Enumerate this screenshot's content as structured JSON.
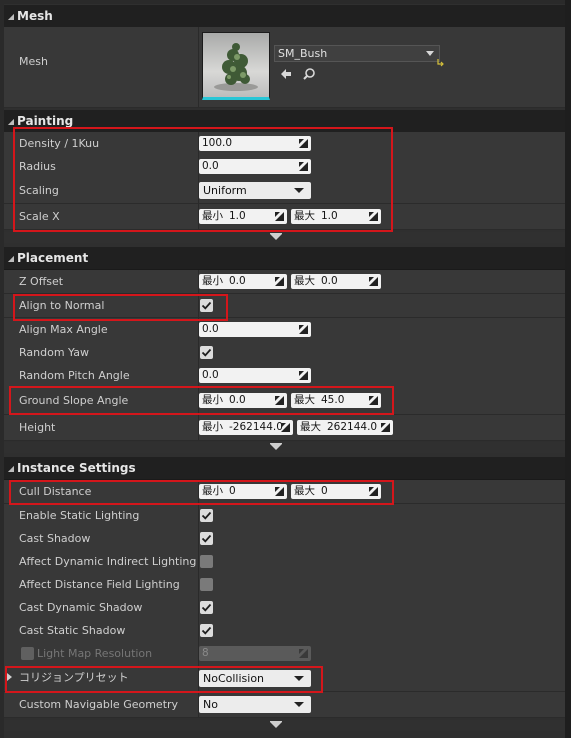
{
  "sections": {
    "mesh": {
      "title": "Mesh"
    },
    "painting": {
      "title": "Painting"
    },
    "placement": {
      "title": "Placement"
    },
    "instance": {
      "title": "Instance Settings"
    }
  },
  "mesh": {
    "label": "Mesh",
    "asset": "SM_Bush"
  },
  "painting": {
    "density_label": "Density / 1Kuu",
    "density_value": "100.0",
    "radius_label": "Radius",
    "radius_value": "0.0",
    "scaling_label": "Scaling",
    "scaling_value": "Uniform",
    "scalex_label": "Scale X",
    "min_tag": "最小",
    "max_tag": "最大",
    "scalex_min": "1.0",
    "scalex_max": "1.0"
  },
  "placement": {
    "zoffset_label": "Z Offset",
    "zoffset_min": "0.0",
    "zoffset_max": "0.0",
    "align_label": "Align to Normal",
    "align_checked": true,
    "alignmax_label": "Align Max Angle",
    "alignmax_value": "0.0",
    "randomyaw_label": "Random Yaw",
    "randomyaw_checked": true,
    "randompitch_label": "Random Pitch Angle",
    "randompitch_value": "0.0",
    "groundslope_label": "Ground Slope Angle",
    "groundslope_min": "0.0",
    "groundslope_max": "45.0",
    "height_label": "Height",
    "height_min": "-262144.0",
    "height_max": "262144.0"
  },
  "instance": {
    "cull_label": "Cull Distance",
    "cull_min": "0",
    "cull_max": "0",
    "static_lighting_label": "Enable Static Lighting",
    "cast_shadow_label": "Cast Shadow",
    "affect_dyn_label": "Affect Dynamic Indirect Lighting",
    "affect_df_label": "Affect Distance Field Lighting",
    "cast_dyn_label": "Cast Dynamic Shadow",
    "cast_static_label": "Cast Static Shadow",
    "lightmap_label": "Light Map Resolution",
    "lightmap_value": "8",
    "collision_label": "コリジョンプリセット",
    "collision_value": "NoCollision",
    "navgeom_label": "Custom Navigable Geometry",
    "navgeom_value": "No"
  },
  "colors": {
    "highlight": "#d4161b",
    "thumb_border": "#28c6d6"
  }
}
